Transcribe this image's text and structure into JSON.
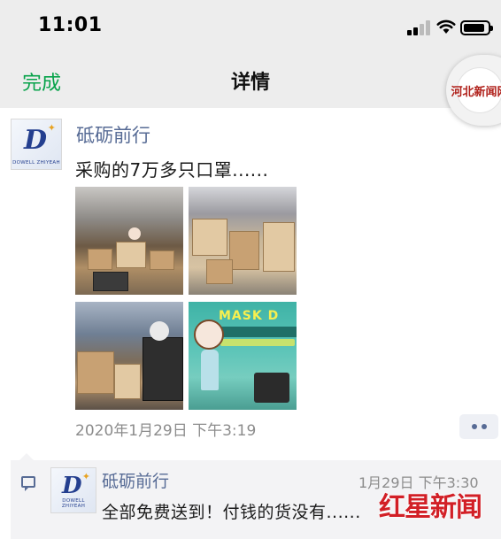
{
  "status_bar": {
    "time": "11:01",
    "signal_icon": "cellular-signal-icon",
    "wifi_icon": "wifi-icon",
    "battery_icon": "battery-icon",
    "battery_level": 0.9
  },
  "nav": {
    "done_label": "完成",
    "title": "详情",
    "capsule_logo_text": "河北新闻网",
    "done_color": "#07a34a"
  },
  "post": {
    "author": "砥砺前行",
    "avatar_icon": "company-logo-avatar",
    "avatar_brand_text": "DOWELL ZHIYEAH",
    "text": "采购的7万多只口罩......",
    "photos": [
      {
        "name": "airport-carts-photo"
      },
      {
        "name": "boxes-on-carts-photo"
      },
      {
        "name": "terminal-boxes-photo"
      },
      {
        "name": "mask-ad-photo",
        "overlay_text": "MASK D"
      }
    ],
    "date": "2020年1月29日 下午3:19",
    "more_icon": "more-dots-icon"
  },
  "comments": [
    {
      "author": "砥砺前行",
      "time": "1月29日 下午3:30",
      "text": "全部免费送到！付钱的货没有......"
    }
  ],
  "watermark": {
    "text": "红星新闻",
    "color": "#d21f26"
  },
  "colors": {
    "link_blue": "#576b95",
    "nav_bg": "#ededed",
    "comment_bg": "#f3f3f5",
    "meta_gray": "#8c8c8c"
  }
}
